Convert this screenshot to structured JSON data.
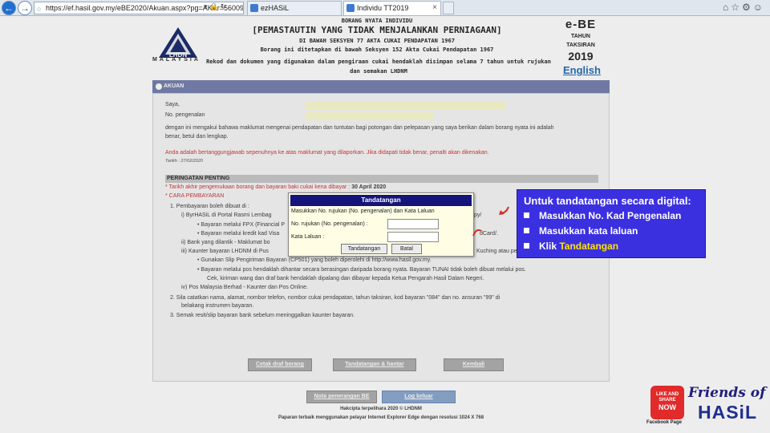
{
  "browser": {
    "url": "https://ef.hasil.gov.my/eBE2020/Akuan.aspx?pg=AK&r=56009732",
    "tabs": [
      {
        "label": "ezHASiL"
      },
      {
        "label": "Individu TT2019"
      }
    ]
  },
  "header": {
    "logo_text": "LHDN",
    "country": "MALAYSIA",
    "line1": "BORANG NYATA INDIVIDU",
    "line2": "[PEMASTAUTIN YANG TIDAK MENJALANKAN PERNIAGAAN]",
    "line3": "DI BAWAH SEKSYEN 77 AKTA CUKAI PENDAPATAN 1967",
    "line4": "Borang ini ditetapkan di bawah Seksyen 152 Akta Cukai Pendapatan 1967",
    "line5": "Rekod dan dokumen yang digunakan dalam pengiraan cukai hendaklah disimpan selama 7 tahun untuk rujukan",
    "line6": "dan semakan LHDNM",
    "form_code": "e-BE",
    "tahun": "TAHUN",
    "taksiran": "TAKSIRAN",
    "year": "2019",
    "english_link": "English"
  },
  "section": {
    "title": "AKUAN",
    "saya": "Saya,",
    "no_pengenalan": "No. pengenalan",
    "decl1": "dengan ini mengakui bahawa maklumat mengenai pendapatan dan tuntutan bagi potongan dan pelepasan yang saya berikan dalam borang nyata ini adalah",
    "decl2": "benar, betul dan lengkap.",
    "warning": "Anda adalah bertanggungjawab sepenuhnya ke atas maklumat yang dilaporkan. Jika didapati tidak benar, penalti akan dikenakan.",
    "tarikh": "Tarikh : 27/02/2020",
    "peringatan": "PERINGATAN PENTING",
    "due_text": "* Tarikh akhir pengemukaan borang dan bayaran baki cukai kena dibayar :",
    "due_date": "30 April 2020",
    "cara": "* CARA PEMBAYARAN",
    "p1": "1.   Pembayaran boleh dibuat di :",
    "p1i": "i)   ByrHASiL di Portal Rasmi Lembag",
    "p1i_tail": "py/",
    "p1i_a": "•  Bayaran melalui FPX (Financial P",
    "p1i_b": "•  Bayaran melalui kredit kad Visa",
    "p1i_b_tail": "dCard/.",
    "p1ii": "ii)   Bank yang dilantik - Maklumat bo",
    "p1iii": "iii)  Kaunter bayaran LHDNM di Pus",
    "p1iii_tail": "Kuching atau pe",
    "p1iii_a": "•  Gunakan Slip Pengiriman Bayaran (CP501) yang boleh diperolehi di http://www.hasil.gov.my.",
    "p1iii_b": "•  Bayaran melalui pos hendaklah dihantar secara berasingan daripada borang nyata. Bayaran TUNAI tidak boleh dibuat melalui pos.",
    "p1iii_c": "Cek, kiriman wang dan draf bank hendaklah dipalang dan dibayar kepada Ketua Pengarah Hasil Dalam Negeri.",
    "p1iv": "iv)  Pos Malaysia Berhad - Kaunter dan Pos Online.",
    "p2a": "2.   Sila catatkan nama, alamat, nombor telefon, nombor cukai pendapatan, tahun taksiran, kod bayaran \"084\" dan no. ansuran \"99\" di",
    "p2b": "belakang instrumen bayaran.",
    "p3": "3.   Semak resit/slip bayaran bank sebelum meninggalkan kaunter bayaran."
  },
  "buttons": {
    "cetak": "Cetak draf borang",
    "tandatangan_hantar": "Tandatangan & hantar",
    "kembali": "Kembali",
    "nota": "Nota penerangan BE",
    "log_keluar": "Log keluar"
  },
  "footer": {
    "copyright": "Hakcipta terpelihara 2020 © LHDNM",
    "browser_note": "Paparan terbaik menggunakan pelayar Internet Explorer Edge dengan resolusi 1024 X 768"
  },
  "dialog": {
    "title": "Tandatangan",
    "instruction": "Masukkan No. rujukan (No. pengenalan) dan Kata Laluan",
    "label_ref": "No. rujukan (No. pengenalan) :",
    "label_pass": "Kata Laluan :",
    "btn_sign": "Tandatangan",
    "btn_cancel": "Batal",
    "ref_value": "",
    "pass_value": ""
  },
  "callout": {
    "title": "Untuk tandatangan secara digital:",
    "item1": "Masukkan No. Kad Pengenalan",
    "item2": "Masukkan kata laluan",
    "item3_prefix": "Klik ",
    "item3_highlight": "Tandatangan"
  },
  "branding": {
    "like1": "LIKE AND",
    "like2": "SHARE",
    "like3": "NOW",
    "fb": "Facebook Page",
    "friends": "Friends of",
    "hasil": "HASiL"
  },
  "colors": {
    "section_bar": "#7883b0",
    "dialog_title": "#14147a",
    "callout_bg": "#3b30e0",
    "callout_highlight": "#ffe400",
    "link": "#2b6fb4",
    "warning": "#d13a3a"
  }
}
